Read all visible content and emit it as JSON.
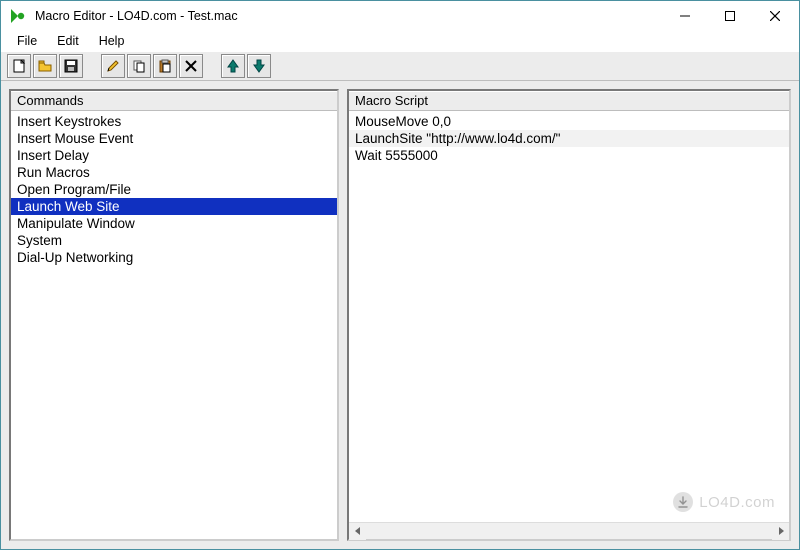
{
  "title": "Macro Editor - LO4D.com - Test.mac",
  "menus": {
    "file": "File",
    "edit": "Edit",
    "help": "Help"
  },
  "panels": {
    "commands_header": "Commands",
    "script_header": "Macro Script"
  },
  "commands": [
    "Insert Keystrokes",
    "Insert Mouse Event",
    "Insert Delay",
    "Run Macros",
    "Open Program/File",
    "Launch Web Site",
    "Manipulate Window",
    "System",
    "Dial-Up Networking"
  ],
  "commands_selected_index": 5,
  "script_lines": [
    "MouseMove 0,0",
    "LaunchSite \"http://www.lo4d.com/\"",
    "Wait 5555000"
  ],
  "script_highlight_index": 1,
  "watermark": "LO4D.com"
}
